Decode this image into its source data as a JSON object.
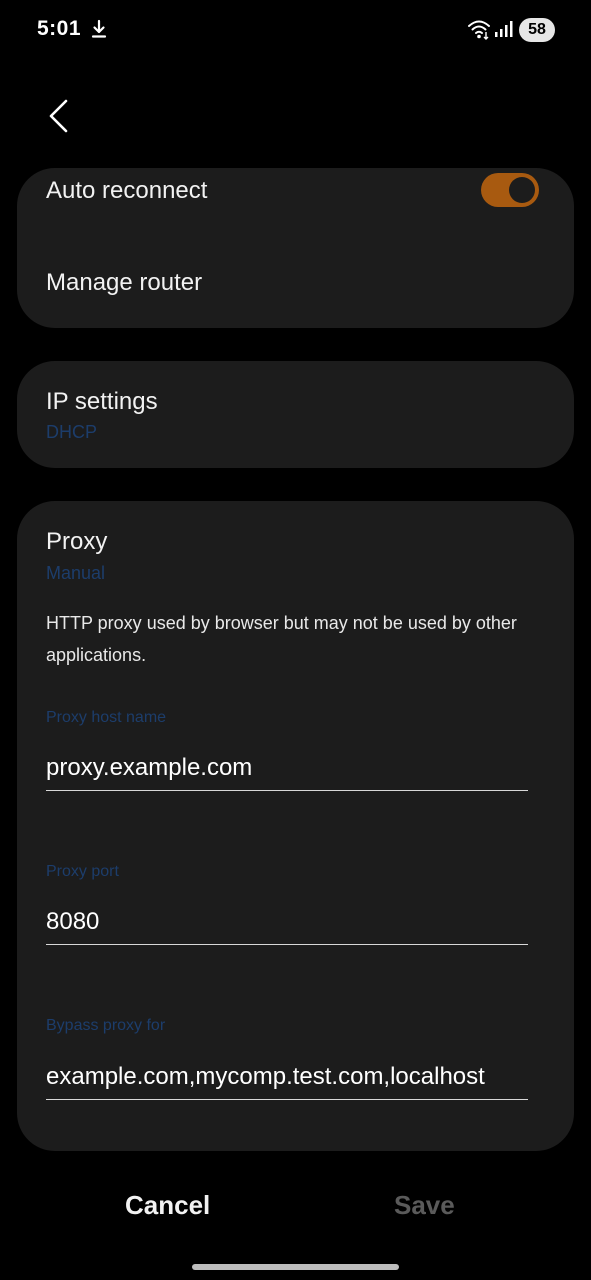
{
  "status_bar": {
    "time": "5:01",
    "battery": "58",
    "icons": [
      "download-icon",
      "wifi-icon",
      "signal-icon"
    ]
  },
  "nav": {
    "back_icon": "chevron-left-icon"
  },
  "auto_reconnect": {
    "label": "Auto reconnect",
    "toggle_on": true,
    "toggle_color": "#a85a10"
  },
  "manage_router": {
    "label": "Manage router"
  },
  "ip_settings": {
    "label": "IP settings",
    "value": "DHCP"
  },
  "proxy": {
    "label": "Proxy",
    "value": "Manual",
    "description": "HTTP proxy used by browser but may not be used by other applications.",
    "host_label": "Proxy host name",
    "host_value": "proxy.example.com",
    "port_label": "Proxy port",
    "port_value": "8080",
    "bypass_label": "Bypass proxy for",
    "bypass_value": "example.com,mycomp.test.com,localhost"
  },
  "actions": {
    "cancel_label": "Cancel",
    "save_label": "Save"
  },
  "colors": {
    "background": "#000000",
    "card": "#1c1c1c",
    "accent_sub": "#1c3d6b",
    "disabled": "#5a5a5a"
  }
}
